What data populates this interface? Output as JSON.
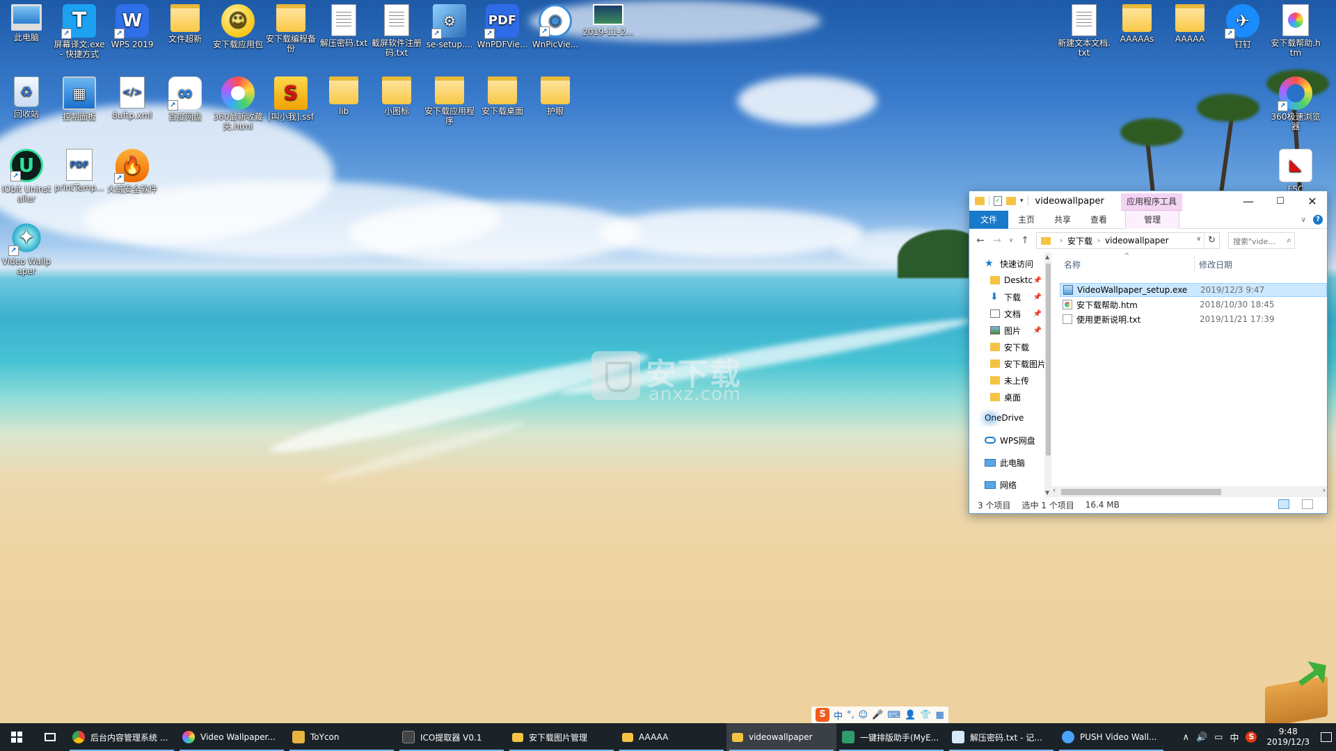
{
  "desktop": {
    "icons_left": [
      {
        "label": "此电脑",
        "icon": "pc-icon",
        "glyph": ""
      },
      {
        "label": "屏幕译文.exe - 快捷方式",
        "icon": "translate-app-icon",
        "glyph": "T"
      },
      {
        "label": "WPS 2019",
        "icon": "wps-icon",
        "glyph": "W"
      },
      {
        "label": "文件超新",
        "icon": "folder-icon",
        "glyph": ""
      },
      {
        "label": "安下载应用包",
        "icon": "smiley-icon",
        "glyph": "☺"
      },
      {
        "label": "安下载编程备份",
        "icon": "folder-icon",
        "glyph": ""
      },
      {
        "label": "解压密码.txt",
        "icon": "text-file-icon",
        "glyph": ""
      },
      {
        "label": "截屏软件注册码.txt",
        "icon": "text-file-icon",
        "glyph": ""
      },
      {
        "label": "se-setup....",
        "icon": "setup-icon",
        "glyph": "⚙"
      },
      {
        "label": "WnPDFVie...",
        "icon": "pdf-viewer-icon",
        "glyph": "PDF"
      },
      {
        "label": "WnPicVie...",
        "icon": "eye-icon",
        "glyph": "◉"
      },
      {
        "label": "2019-11-2...",
        "icon": "image-file-icon",
        "glyph": ""
      }
    ],
    "icons_row2": [
      {
        "label": "回收站",
        "icon": "recycle-bin-icon",
        "glyph": "♻"
      },
      {
        "label": "控制面板",
        "icon": "control-panel-icon",
        "glyph": "▦"
      },
      {
        "label": "8uftp.xml",
        "icon": "xml-file-icon",
        "glyph": "</>"
      },
      {
        "label": "百度网盘",
        "icon": "baidu-netdisk-icon",
        "glyph": "∞"
      },
      {
        "label": "360最新收藏夹.html",
        "icon": "360-browser-icon",
        "glyph": ""
      },
      {
        "label": "[叫小我].ssf",
        "icon": "ssf-file-icon",
        "glyph": "S"
      },
      {
        "label": "lib",
        "icon": "folder-icon",
        "glyph": ""
      },
      {
        "label": "小图标",
        "icon": "folder-icon",
        "glyph": ""
      },
      {
        "label": "安下载应用程序",
        "icon": "folder-icon",
        "glyph": ""
      },
      {
        "label": "安下载桌面",
        "icon": "folder-icon",
        "glyph": ""
      },
      {
        "label": "护眼",
        "icon": "folder-icon",
        "glyph": ""
      }
    ],
    "icons_row3": [
      {
        "label": "IObit Uninstaller",
        "icon": "iobit-icon",
        "glyph": "U"
      },
      {
        "label": "printTemp...",
        "icon": "pdf-file-icon",
        "glyph": "PDF"
      },
      {
        "label": "火绒安全软件",
        "icon": "huorong-icon",
        "glyph": "🔥"
      }
    ],
    "icons_row4": [
      {
        "label": "Video Wallpaper",
        "icon": "video-wallpaper-icon",
        "glyph": "✦"
      }
    ],
    "icons_right": [
      {
        "label": "新建文本文档.txt",
        "icon": "text-file-icon",
        "glyph": ""
      },
      {
        "label": "AAAAAs",
        "icon": "folder-icon",
        "glyph": ""
      },
      {
        "label": "AAAAA",
        "icon": "folder-icon",
        "glyph": ""
      },
      {
        "label": "钉钉",
        "icon": "dingtalk-icon",
        "glyph": "✈"
      },
      {
        "label": "安下载帮助.htm",
        "icon": "htm-file-icon",
        "glyph": ""
      }
    ],
    "icons_right2": [
      {
        "label": "360极速浏览器",
        "icon": "360-speed-browser-icon",
        "glyph": ""
      },
      {
        "label": "FSC",
        "icon": "fsc-icon",
        "glyph": "◣"
      }
    ],
    "watermark": {
      "big": "安下载",
      "small": "anxz.com"
    }
  },
  "explorer": {
    "title": "videowallpaper",
    "app_tools_header": "应用程序工具",
    "window_buttons": {
      "minimize": "—",
      "maximize": "☐",
      "close": "✕"
    },
    "ribbon_tabs": [
      "文件",
      "主页",
      "共享",
      "查看"
    ],
    "manage_tab": "管理",
    "address": {
      "crumbs": [
        "安下载",
        "videowallpaper"
      ]
    },
    "search": {
      "placeholder": "搜索\"vide..."
    },
    "nav_pane": [
      {
        "label": "快速访问",
        "icon": "star-icon",
        "pinned": false,
        "kind": "star"
      },
      {
        "label": "Desktc",
        "icon": "folder-icon",
        "pinned": true,
        "kind": "fold"
      },
      {
        "label": "下载",
        "icon": "download-icon",
        "pinned": true,
        "kind": "down"
      },
      {
        "label": "文档",
        "icon": "documents-icon",
        "pinned": true,
        "kind": "docs"
      },
      {
        "label": "图片",
        "icon": "pictures-icon",
        "pinned": true,
        "kind": "pics"
      },
      {
        "label": "安下载",
        "icon": "folder-icon",
        "pinned": false,
        "kind": "fold"
      },
      {
        "label": "安下载图片",
        "icon": "folder-icon",
        "pinned": false,
        "kind": "fold"
      },
      {
        "label": "未上传",
        "icon": "folder-icon",
        "pinned": false,
        "kind": "fold"
      },
      {
        "label": "桌面",
        "icon": "folder-icon",
        "pinned": false,
        "kind": "fold"
      },
      {
        "label": "OneDrive",
        "icon": "onedrive-icon",
        "pinned": false,
        "kind": "cloud"
      },
      {
        "label": "WPS网盘",
        "icon": "wps-cloud-icon",
        "pinned": false,
        "kind": "wcloud"
      },
      {
        "label": "此电脑",
        "icon": "pc-icon",
        "pinned": false,
        "kind": "pc"
      },
      {
        "label": "网络",
        "icon": "network-icon",
        "pinned": false,
        "kind": "net"
      }
    ],
    "columns": {
      "name": "名称",
      "date": "修改日期"
    },
    "files": [
      {
        "name": "VideoWallpaper_setup.exe",
        "date": "2019/12/3 9:47",
        "type": "exe",
        "selected": true
      },
      {
        "name": "安下载帮助.htm",
        "date": "2018/10/30 18:45",
        "type": "htm",
        "selected": false
      },
      {
        "name": "使用更新说明.txt",
        "date": "2019/11/21 17:39",
        "type": "txt",
        "selected": false
      }
    ],
    "status": {
      "count": "3 个项目",
      "selection": "选中 1 个项目",
      "size": "16.4 MB"
    }
  },
  "ime": {
    "items": [
      "S",
      "中",
      "°,",
      "☺",
      "🎤",
      "⌨",
      "👤",
      "👕",
      "▦"
    ]
  },
  "taskbar": {
    "items": [
      {
        "label": "后台内容管理系统 ...",
        "icon": "chrome",
        "active": false
      },
      {
        "label": "Video Wallpaper...",
        "icon": "vw",
        "active": false
      },
      {
        "label": "ToYcon",
        "icon": "toy",
        "active": false
      },
      {
        "label": "ICO提取器 V0.1",
        "icon": "ico",
        "active": false
      },
      {
        "label": "安下载图片管理",
        "icon": "folder",
        "active": false
      },
      {
        "label": "AAAAA",
        "icon": "folder",
        "active": false
      },
      {
        "label": "videowallpaper",
        "icon": "folder",
        "active": true
      },
      {
        "label": "一键排版助手(MyE...",
        "icon": "green",
        "active": false
      },
      {
        "label": "解压密码.txt - 记...",
        "icon": "note",
        "active": false
      },
      {
        "label": "PUSH Video Wall...",
        "icon": "push",
        "active": false
      }
    ],
    "tray": {
      "chevron": "∧",
      "volume": "🔊",
      "net": "▭",
      "ime": "中",
      "sogou": "S"
    },
    "clock": {
      "time": "9:48",
      "date": "2019/12/3"
    }
  }
}
